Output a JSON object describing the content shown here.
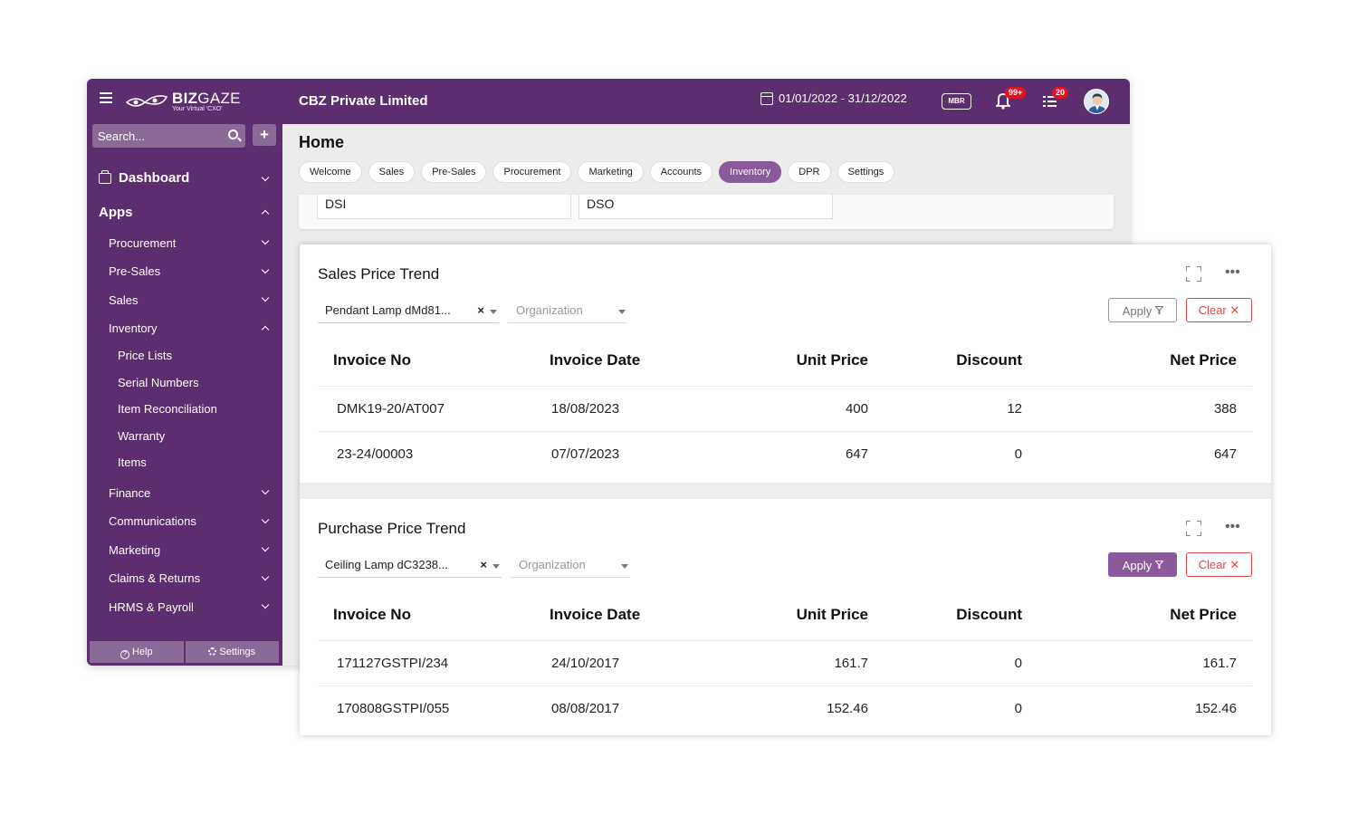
{
  "app": {
    "brand": {
      "name_bold": "BIZ",
      "name_light": "GAZE",
      "tagline": "Your Virtual 'CXO'"
    },
    "company": "CBZ Private Limited",
    "date_range": "01/01/2022 - 31/12/2022",
    "mbr_label": "MBR",
    "notification_count": "99+",
    "task_count": "20"
  },
  "sidebar": {
    "search_placeholder": "Search...",
    "add_label": "+",
    "dashboard": "Dashboard",
    "apps": "Apps",
    "items": [
      {
        "label": "Procurement"
      },
      {
        "label": "Pre-Sales"
      },
      {
        "label": "Sales"
      },
      {
        "label": "Inventory"
      }
    ],
    "inventory_sub": [
      "Price Lists",
      "Serial Numbers",
      "Item Reconciliation",
      "Warranty",
      "Items"
    ],
    "more_items": [
      "Finance",
      "Communications",
      "Marketing",
      "Claims & Returns",
      "HRMS & Payroll"
    ],
    "footer": {
      "help": "Help",
      "settings": "Settings"
    }
  },
  "main": {
    "title": "Home",
    "tabs": [
      "Welcome",
      "Sales",
      "Pre-Sales",
      "Procurement",
      "Marketing",
      "Accounts",
      "Inventory",
      "DPR",
      "Settings"
    ],
    "active_tab": "Inventory",
    "kpis": [
      "DSI",
      "DSO"
    ]
  },
  "sales_trend": {
    "title": "Sales Price Trend",
    "item_filter": "Pendant Lamp dMd81...",
    "org_placeholder": "Organization",
    "apply_label": "Apply",
    "clear_label": "Clear",
    "columns": [
      "Invoice No",
      "Invoice Date",
      "Unit Price",
      "Discount",
      "Net Price"
    ],
    "rows": [
      [
        "DMK19-20/AT007",
        "18/08/2023",
        "400",
        "12",
        "388"
      ],
      [
        "23-24/00003",
        "07/07/2023",
        "647",
        "0",
        "647"
      ]
    ]
  },
  "purchase_trend": {
    "title": "Purchase Price Trend",
    "item_filter": "Ceiling Lamp dC3238...",
    "org_placeholder": "Organization",
    "apply_label": "Apply",
    "clear_label": "Clear",
    "columns": [
      "Invoice No",
      "Invoice Date",
      "Unit Price",
      "Discount",
      "Net Price"
    ],
    "rows": [
      [
        "171127GSTPI/234",
        "24/10/2017",
        "161.7",
        "0",
        "161.7"
      ],
      [
        "170808GSTPI/055",
        "08/08/2017",
        "152.46",
        "0",
        "152.46"
      ]
    ]
  },
  "colors": {
    "brand_purple": "#5d2e6f",
    "accent_purple": "#8a5a9b",
    "clear_red": "#e04747",
    "badge_red": "#e3121f"
  }
}
